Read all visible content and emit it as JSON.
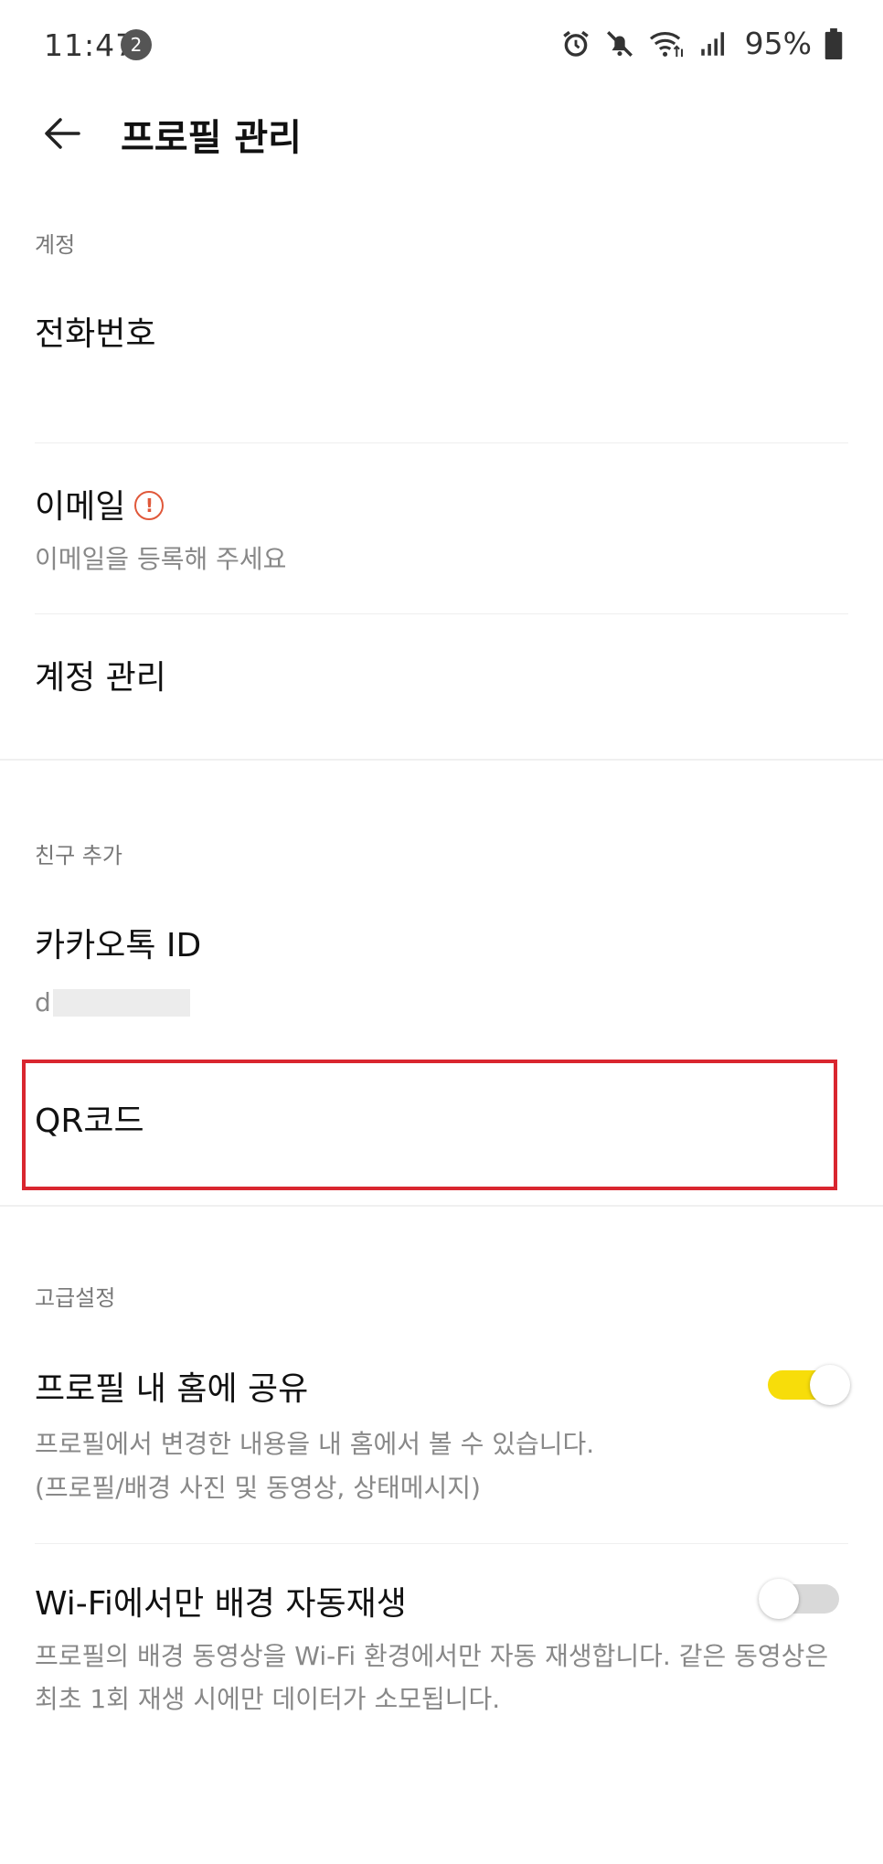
{
  "status_bar": {
    "time": "11:47",
    "notification_count": "2",
    "battery": "95%",
    "icons": [
      "alarm-icon",
      "mute-icon",
      "wifi-icon",
      "signal-icon",
      "battery-icon"
    ]
  },
  "header": {
    "back_icon": "arrow-left-icon",
    "title": "프로필 관리"
  },
  "account_section": {
    "header": "계정",
    "phone": {
      "title": "전화번호"
    },
    "email": {
      "title": "이메일",
      "warning_icon": "!",
      "subtitle": "이메일을 등록해 주세요"
    },
    "account_manage": {
      "title": "계정 관리"
    }
  },
  "add_friend_section": {
    "header": "친구 추가",
    "kakao_id": {
      "title": "카카오톡 ID",
      "value_visible": "d"
    },
    "qr_code": {
      "title": "QR코드"
    }
  },
  "advanced_section": {
    "header": "고급설정",
    "share_profile": {
      "title": "프로필 내 홈에 공유",
      "desc_line1": "프로필에서 변경한 내용을 내 홈에서 볼 수 있습니다.",
      "desc_line2": "(프로필/배경 사진 및 동영상, 상태메시지)",
      "toggle_on": true
    },
    "wifi_autoplay": {
      "title": "Wi-Fi에서만 배경 자동재생",
      "description": "프로필의 배경 동영상을 Wi-Fi 환경에서만 자동 재생합니다. 같은 동영상은 최초 1회 재생 시에만 데이터가 소모됩니다.",
      "toggle_on": false
    }
  },
  "colors": {
    "accent_yellow": "#f7dd0a",
    "warning_orange": "#e0583a",
    "highlight_red": "#d9262f"
  }
}
